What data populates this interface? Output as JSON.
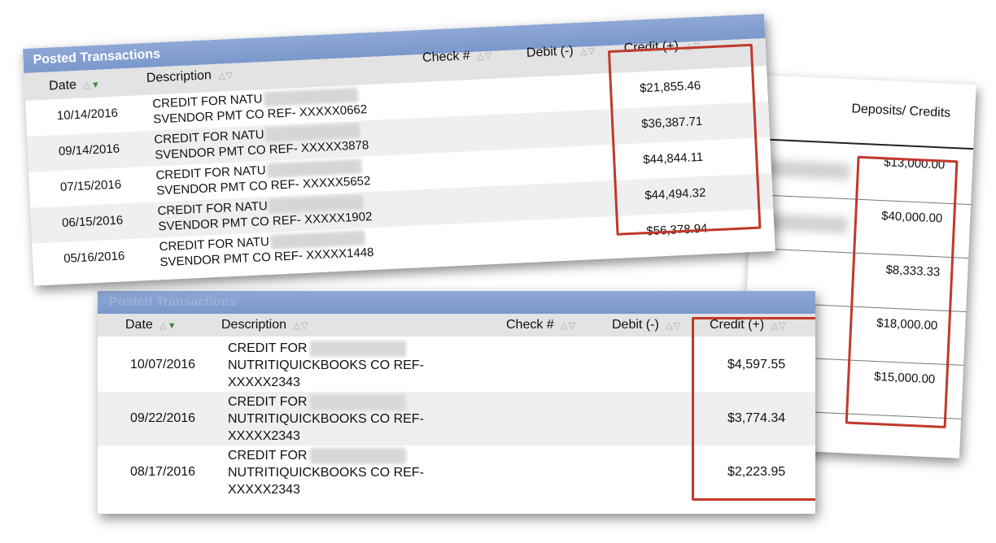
{
  "deposits_card": {
    "header": "Deposits/ Credits",
    "amounts": [
      "$13,000.00",
      "$40,000.00",
      "$8,333.33",
      "$18,000.00",
      "$15,000.00"
    ]
  },
  "top_card": {
    "title": "Posted Transactions",
    "columns": {
      "date": "Date",
      "description": "Description",
      "check": "Check #",
      "debit": "Debit (-)",
      "credit": "Credit (+)"
    },
    "sort_icon": "△▽",
    "rows": [
      {
        "date": "10/14/2016",
        "desc_line1": "CREDIT FOR NATU",
        "desc_line2": "SVENDOR PMT CO REF- XXXXX0662",
        "credit": "$21,855.46"
      },
      {
        "date": "09/14/2016",
        "desc_line1": "CREDIT FOR NATU",
        "desc_line2": "SVENDOR PMT CO REF- XXXXX3878",
        "credit": "$36,387.71"
      },
      {
        "date": "07/15/2016",
        "desc_line1": "CREDIT FOR NATU",
        "desc_line2": "SVENDOR PMT CO REF- XXXXX5652",
        "credit": "$44,844.11"
      },
      {
        "date": "06/15/2016",
        "desc_line1": "CREDIT FOR NATU",
        "desc_line2": "SVENDOR PMT CO REF- XXXXX1902",
        "credit": "$44,494.32"
      },
      {
        "date": "05/16/2016",
        "desc_line1": "CREDIT FOR NATU",
        "desc_line2": "SVENDOR PMT CO REF- XXXXX1448",
        "credit": "$56,378.94"
      }
    ]
  },
  "bottom_card": {
    "title": "Posted Transactions",
    "columns": {
      "date": "Date",
      "description": "Description",
      "check": "Check #",
      "debit": "Debit (-)",
      "credit": "Credit (+)"
    },
    "rows": [
      {
        "date": "10/07/2016",
        "desc_line1": "CREDIT FOR",
        "desc_line2": "NUTRITIQUICKBOOKS CO REF-",
        "desc_line3": "XXXXX2343",
        "credit": "$4,597.55"
      },
      {
        "date": "09/22/2016",
        "desc_line1": "CREDIT FOR",
        "desc_line2": "NUTRITIQUICKBOOKS CO REF-",
        "desc_line3": "XXXXX2343",
        "credit": "$3,774.34"
      },
      {
        "date": "08/17/2016",
        "desc_line1": "CREDIT FOR",
        "desc_line2": "NUTRITIQUICKBOOKS CO REF-",
        "desc_line3": "XXXXX2343",
        "credit": "$2,223.95"
      }
    ]
  },
  "colors": {
    "highlight_box": "#c0392b",
    "title_bar": "#7b98cc",
    "header_row": "#e3e3e3",
    "alt_row": "#efefef",
    "sort_active": "#3c8a3c"
  }
}
